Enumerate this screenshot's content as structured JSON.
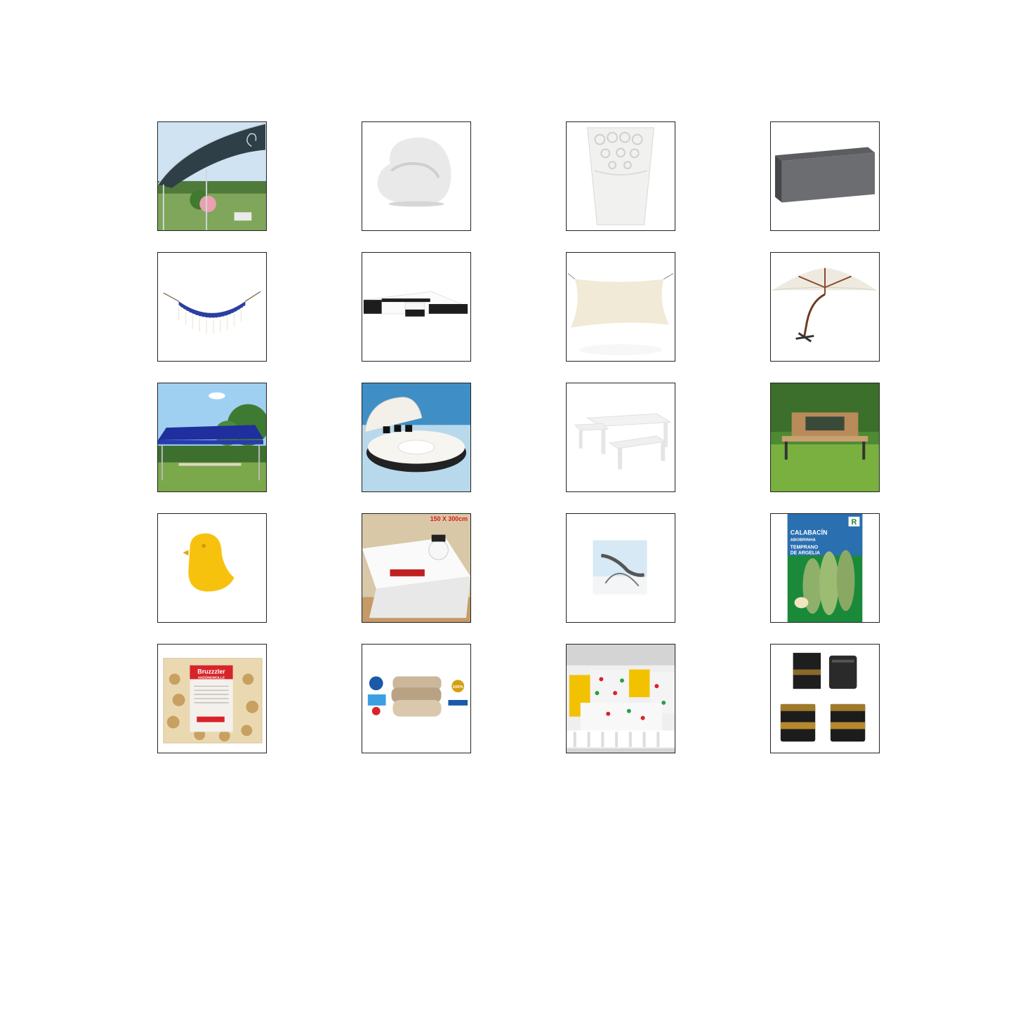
{
  "products": [
    {
      "icon": "gazebo-canopy-icon"
    },
    {
      "icon": "egg-chair-icon"
    },
    {
      "icon": "lace-planter-icon"
    },
    {
      "icon": "planter-box-icon"
    },
    {
      "icon": "hammock-icon"
    },
    {
      "icon": "rattan-sofa-set-icon"
    },
    {
      "icon": "sun-shade-sail-icon"
    },
    {
      "icon": "cantilever-umbrella-icon"
    },
    {
      "icon": "blue-tent-icon"
    },
    {
      "icon": "round-daybed-icon"
    },
    {
      "icon": "picnic-table-icon"
    },
    {
      "icon": "garden-bench-icon"
    },
    {
      "icon": "yellow-bird-icon"
    },
    {
      "icon": "snowman-tablecloth-icon",
      "text": "150 X 300cm"
    },
    {
      "icon": "lounge-chair-icon"
    },
    {
      "icon": "zucchini-seed-packet-icon",
      "brand": "R",
      "title": "CALABACÍN",
      "subtitle": "ABOBRINHA",
      "variety_1": "TEMPRANO",
      "variety_2": "DE ARGELIA"
    },
    {
      "icon": "fire-starter-bag-icon",
      "brand": "Bruzzzler",
      "subtitle": "ANZÜNDWOLLE"
    },
    {
      "icon": "pillows-icon",
      "badge": "100%"
    },
    {
      "icon": "crib-bumper-icon"
    },
    {
      "icon": "candle-set-icon"
    }
  ]
}
